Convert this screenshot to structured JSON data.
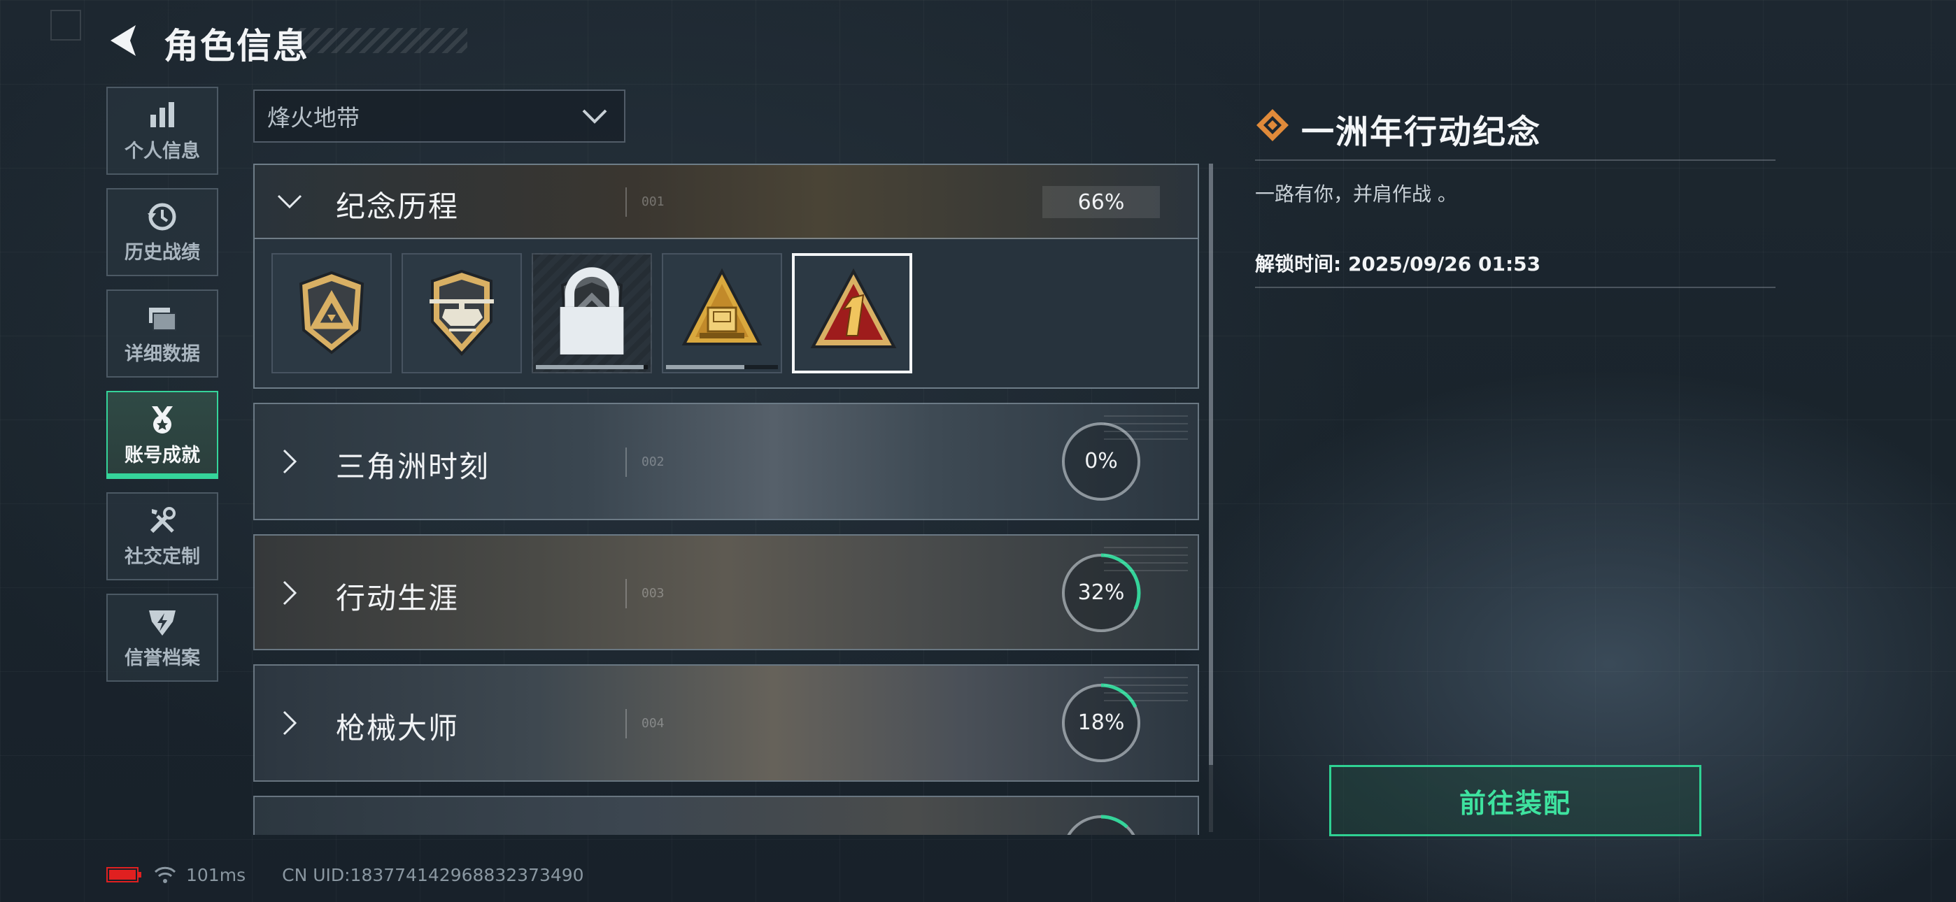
{
  "header": {
    "title": "角色信息"
  },
  "sidebar": {
    "items": [
      {
        "label": "个人信息",
        "icon": "bar-chart-icon",
        "active": false
      },
      {
        "label": "历史战绩",
        "icon": "history-clock-icon",
        "active": false
      },
      {
        "label": "详细数据",
        "icon": "folder-icon",
        "active": false
      },
      {
        "label": "账号成就",
        "icon": "medal-icon",
        "active": true
      },
      {
        "label": "社交定制",
        "icon": "tools-icon",
        "active": false
      },
      {
        "label": "信誉档案",
        "icon": "reputation-icon",
        "active": false
      }
    ]
  },
  "mode_select": {
    "value": "烽火地带"
  },
  "categories": [
    {
      "name": "纪念历程",
      "num": "001",
      "percent_label": "66%",
      "progress": 0.66,
      "expanded": true
    },
    {
      "name": "三角洲时刻",
      "num": "002",
      "percent_label": "0%",
      "progress": 0.0
    },
    {
      "name": "行动生涯",
      "num": "003",
      "percent_label": "32%",
      "progress": 0.32
    },
    {
      "name": "枪械大师",
      "num": "004",
      "percent_label": "18%",
      "progress": 0.18
    },
    {
      "name": "",
      "num": "",
      "percent_label": "",
      "progress": 0.12
    }
  ],
  "badges": [
    {
      "icon": "shield-triangle-badge-icon",
      "locked": false,
      "selected": false
    },
    {
      "icon": "helicopter-badge-icon",
      "locked": false,
      "selected": false
    },
    {
      "icon": "diamond-shield-badge-icon",
      "locked": true,
      "selected": false,
      "progress": 0.96
    },
    {
      "icon": "gold-bar-pyramid-badge-icon",
      "locked": false,
      "selected": false,
      "progress": 0.7
    },
    {
      "icon": "number-one-triangle-badge-icon",
      "locked": false,
      "selected": true
    }
  ],
  "detail": {
    "title": "一洲年行动纪念",
    "description": "一路有你，并肩作战 。",
    "unlock_time": "解锁时间: 2025/09/26 01:53",
    "equip_button": "前往装配"
  },
  "status": {
    "ping": "101ms",
    "uid": "CN UID:183774142968832373490"
  },
  "colors": {
    "accent": "#35d49a",
    "brand_orange": "#e08a3a",
    "battery_red": "#e02020"
  }
}
